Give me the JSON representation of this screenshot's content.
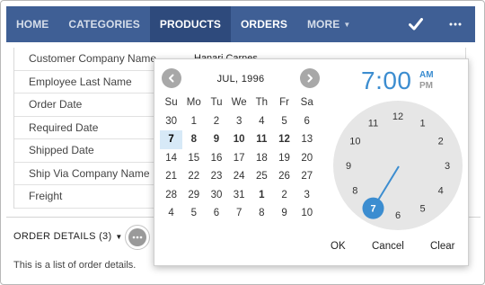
{
  "nav": {
    "items": [
      {
        "label": "HOME",
        "state": "normal"
      },
      {
        "label": "CATEGORIES",
        "state": "normal"
      },
      {
        "label": "PRODUCTS",
        "state": "active"
      },
      {
        "label": "ORDERS",
        "state": "highlight"
      },
      {
        "label": "MORE",
        "state": "dropdown"
      }
    ],
    "icons": [
      "check-icon",
      "more-horizontal-icon"
    ]
  },
  "form": {
    "rows": [
      {
        "label": "Customer Company Name",
        "value": "Hanari Carnes"
      },
      {
        "label": "Employee Last Name",
        "value": ""
      },
      {
        "label": "Order Date",
        "value": ""
      },
      {
        "label": "Required Date",
        "value": ""
      },
      {
        "label": "Shipped Date",
        "value": ""
      },
      {
        "label": "Ship Via Company Name",
        "value": ""
      },
      {
        "label": "Freight",
        "value": ""
      }
    ]
  },
  "details": {
    "title": "ORDER DETAILS (3)",
    "description": "This is a list of order details."
  },
  "picker": {
    "month_title": "JUL, 1996",
    "weekdays": [
      "Su",
      "Mo",
      "Tu",
      "We",
      "Th",
      "Fr",
      "Sa"
    ],
    "weeks": [
      [
        "30",
        "1",
        "2",
        "3",
        "4",
        "5",
        "6"
      ],
      [
        "7",
        "8",
        "9",
        "10",
        "11",
        "12",
        "13"
      ],
      [
        "14",
        "15",
        "16",
        "17",
        "18",
        "19",
        "20"
      ],
      [
        "21",
        "22",
        "23",
        "24",
        "25",
        "26",
        "27"
      ],
      [
        "28",
        "29",
        "30",
        "31",
        "1",
        "2",
        "3"
      ],
      [
        "4",
        "5",
        "6",
        "7",
        "8",
        "9",
        "10"
      ]
    ],
    "selected_day": "7",
    "time": "7:00",
    "am": "AM",
    "pm": "PM",
    "clock_numbers": [
      "12",
      "1",
      "2",
      "3",
      "4",
      "5",
      "6",
      "7",
      "8",
      "9",
      "10",
      "11"
    ],
    "selected_hour": "7",
    "actions": {
      "ok": "OK",
      "cancel": "Cancel",
      "clear": "Clear"
    }
  },
  "colors": {
    "nav_bg": "#3f5f95",
    "nav_active": "#2e4a7c",
    "accent": "#3c8dd0",
    "selected_day_bg": "#d7e9f7",
    "clock_face": "#e6e6e6",
    "clock_hand": "#3c8dd0"
  }
}
